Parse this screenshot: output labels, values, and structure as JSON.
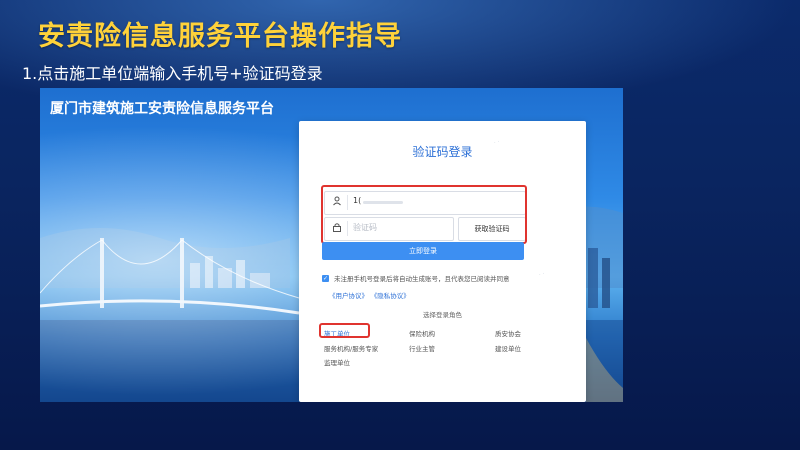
{
  "slide": {
    "title": "安责险信息服务平台操作指导",
    "step": "1.点击施工单位端输入手机号+验证码登录"
  },
  "platform": {
    "name": "厦门市建筑施工安责险信息服务平台"
  },
  "login": {
    "title": "验证码登录",
    "phone_value": "1(",
    "code_placeholder": "验证码",
    "get_code_label": "获取验证码",
    "submit_label": "立即登录",
    "agreement_text": "未注册手机号登录后将自动生成账号，且代表您已阅读并同意",
    "user_agreement": "《用户协议》",
    "privacy_agreement": "《隐私协议》",
    "role_section_title": "选择登录角色",
    "roles": [
      "施工单位",
      "保险机构",
      "质安协会",
      "服务机构/服务专家",
      "行业主管",
      "建设单位",
      "监理单位"
    ],
    "selected_role": "施工单位"
  },
  "icons": {
    "phone": "user-icon",
    "code": "lock-icon",
    "checkbox": "check-icon"
  },
  "colors": {
    "title_yellow": "#ffd23a",
    "accent_blue": "#3d8ff2",
    "highlight_red": "#e0342f"
  }
}
